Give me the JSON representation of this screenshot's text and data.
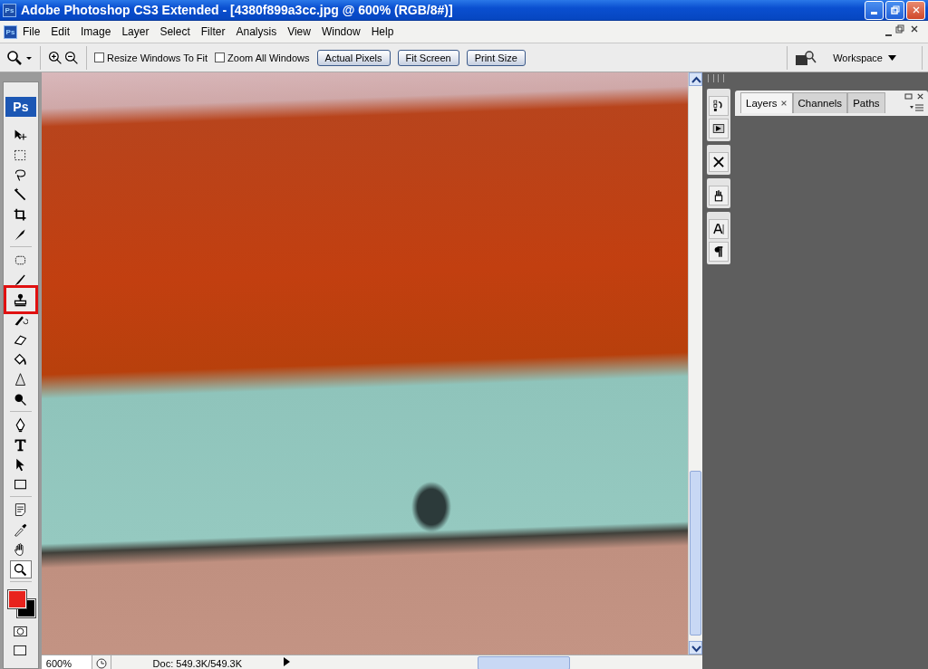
{
  "window": {
    "icon_text": "Ps",
    "title": "Adobe Photoshop CS3 Extended - [4380f899a3cc.jpg @ 600% (RGB/8#)]"
  },
  "menu_bar": {
    "icon_text": "Ps",
    "items": [
      "File",
      "Edit",
      "Image",
      "Layer",
      "Select",
      "Filter",
      "Analysis",
      "View",
      "Window",
      "Help"
    ]
  },
  "options_bar": {
    "checkboxes": [
      {
        "label": "Resize Windows To Fit",
        "checked": false
      },
      {
        "label": "Zoom All Windows",
        "checked": false
      }
    ],
    "buttons": [
      "Actual Pixels",
      "Fit Screen",
      "Print Size"
    ],
    "workspace": "Workspace"
  },
  "toolbox": {
    "logo": "Ps",
    "tool_groups": [
      {
        "tools": [
          {
            "kind": "move",
            "selected": false,
            "highlighted": false
          },
          {
            "kind": "marquee",
            "selected": false,
            "highlighted": false
          },
          {
            "kind": "lasso",
            "selected": false,
            "highlighted": false
          },
          {
            "kind": "wand",
            "selected": false,
            "highlighted": false
          },
          {
            "kind": "crop",
            "selected": false,
            "highlighted": false
          },
          {
            "kind": "slice",
            "selected": false,
            "highlighted": false
          }
        ]
      },
      {
        "tools": [
          {
            "kind": "healing",
            "selected": false,
            "highlighted": false
          },
          {
            "kind": "brush",
            "selected": false,
            "highlighted": false
          },
          {
            "kind": "stamp",
            "selected": false,
            "highlighted": true
          },
          {
            "kind": "history",
            "selected": false,
            "highlighted": false
          },
          {
            "kind": "eraser",
            "selected": false,
            "highlighted": false
          },
          {
            "kind": "bucket",
            "selected": false,
            "highlighted": false
          },
          {
            "kind": "blur",
            "selected": false,
            "highlighted": false
          },
          {
            "kind": "dodge",
            "selected": false,
            "highlighted": false
          }
        ]
      },
      {
        "tools": [
          {
            "kind": "pen",
            "selected": false,
            "highlighted": false
          },
          {
            "kind": "type",
            "selected": false,
            "highlighted": false
          },
          {
            "kind": "arrow",
            "selected": false,
            "highlighted": false
          },
          {
            "kind": "shape",
            "selected": false,
            "highlighted": false
          }
        ]
      },
      {
        "tools": [
          {
            "kind": "notes",
            "selected": false,
            "highlighted": false
          },
          {
            "kind": "eyedropper",
            "selected": false,
            "highlighted": false
          },
          {
            "kind": "hand",
            "selected": false,
            "highlighted": false
          },
          {
            "kind": "zoom",
            "selected": true,
            "highlighted": false
          }
        ]
      }
    ],
    "swatches": [
      {
        "kind": "foreground",
        "color": "#e8231d"
      },
      {
        "kind": "background",
        "color": "#000000"
      }
    ]
  },
  "status_bar": {
    "zoom": "600%",
    "doc": "Doc: 549.3K/549.3K"
  },
  "dock": {
    "groups": [
      {
        "icons": [
          {
            "kind": "history"
          },
          {
            "kind": "actions"
          }
        ]
      },
      {
        "icons": [
          {
            "kind": "tool-presets"
          }
        ]
      },
      {
        "icons": [
          {
            "kind": "brushes"
          }
        ]
      },
      {
        "icons": [
          {
            "kind": "character"
          },
          {
            "kind": "paragraph"
          }
        ]
      }
    ]
  },
  "panel": {
    "tabs": [
      {
        "label": "Layers",
        "selected": true
      },
      {
        "label": "Channels",
        "selected": false
      },
      {
        "label": "Paths",
        "selected": false
      }
    ]
  }
}
